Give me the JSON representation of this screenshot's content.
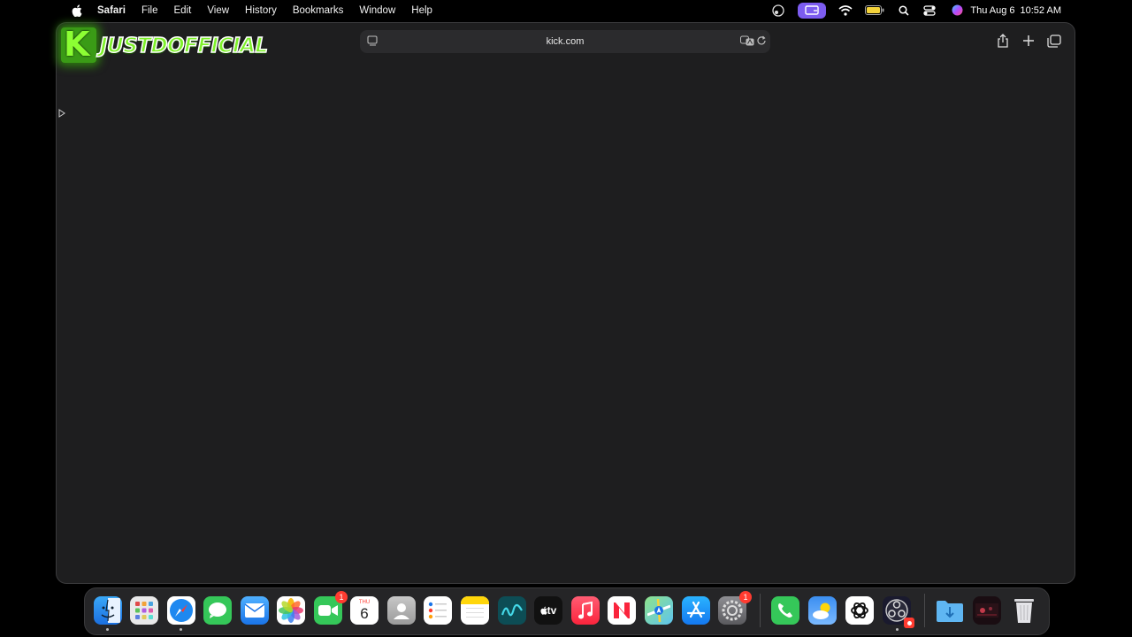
{
  "menubar": {
    "apple_icon": "apple-logo-icon",
    "app_name": "Safari",
    "items": [
      "File",
      "Edit",
      "View",
      "History",
      "Bookmarks",
      "Window",
      "Help"
    ],
    "date": "Thu Aug 6",
    "time": "10:52 AM",
    "status_icons": [
      "screen-share-icon",
      "screen-mirroring-icon",
      "wifi-icon",
      "battery-icon",
      "spotlight-search-icon",
      "control-center-icon",
      "siri-icon"
    ],
    "mirroring_color": "#7c5cf0"
  },
  "browser": {
    "url": "kick.com",
    "toolbar_icons": [
      "sidebar-icon",
      "translate-icon",
      "reload-icon",
      "share-icon",
      "new-tab-icon",
      "tab-overview-icon"
    ]
  },
  "overlay": {
    "logo_letter": "K",
    "logo_text": "JUSTDOFFICIAL",
    "logo_color": "#7ef02a"
  },
  "dock": {
    "apps": [
      {
        "name": "Finder",
        "icon": "finder-icon",
        "running": true
      },
      {
        "name": "Launchpad",
        "icon": "launchpad-icon"
      },
      {
        "name": "Safari",
        "icon": "safari-icon",
        "running": true
      },
      {
        "name": "Messages",
        "icon": "messages-icon"
      },
      {
        "name": "Mail",
        "icon": "mail-icon"
      },
      {
        "name": "Photos",
        "icon": "photos-icon"
      },
      {
        "name": "FaceTime",
        "icon": "facetime-icon",
        "badge": "1"
      },
      {
        "name": "Calendar",
        "icon": "calendar-icon",
        "calendar_month": "THU",
        "calendar_day": "6"
      },
      {
        "name": "Contacts",
        "icon": "contacts-icon"
      },
      {
        "name": "Reminders",
        "icon": "reminders-icon"
      },
      {
        "name": "Notes",
        "icon": "notes-icon"
      },
      {
        "name": "Freeform",
        "icon": "freeform-icon"
      },
      {
        "name": "TV",
        "icon": "apple-tv-icon",
        "label": "tv"
      },
      {
        "name": "Music",
        "icon": "music-icon"
      },
      {
        "name": "News",
        "icon": "news-icon"
      },
      {
        "name": "Maps",
        "icon": "maps-icon"
      },
      {
        "name": "App Store",
        "icon": "app-store-icon"
      },
      {
        "name": "System Settings",
        "icon": "system-settings-icon",
        "badge": "1"
      },
      {
        "name": "Phone",
        "icon": "phone-icon"
      },
      {
        "name": "Weather",
        "icon": "weather-icon"
      },
      {
        "name": "ChatGPT",
        "icon": "chatgpt-icon"
      },
      {
        "name": "OBS",
        "icon": "obs-icon",
        "running": true
      },
      {
        "name": "Downloads",
        "icon": "downloads-folder-icon"
      },
      {
        "name": "Recent",
        "icon": "recent-stack-icon"
      },
      {
        "name": "Trash",
        "icon": "trash-icon"
      }
    ]
  }
}
